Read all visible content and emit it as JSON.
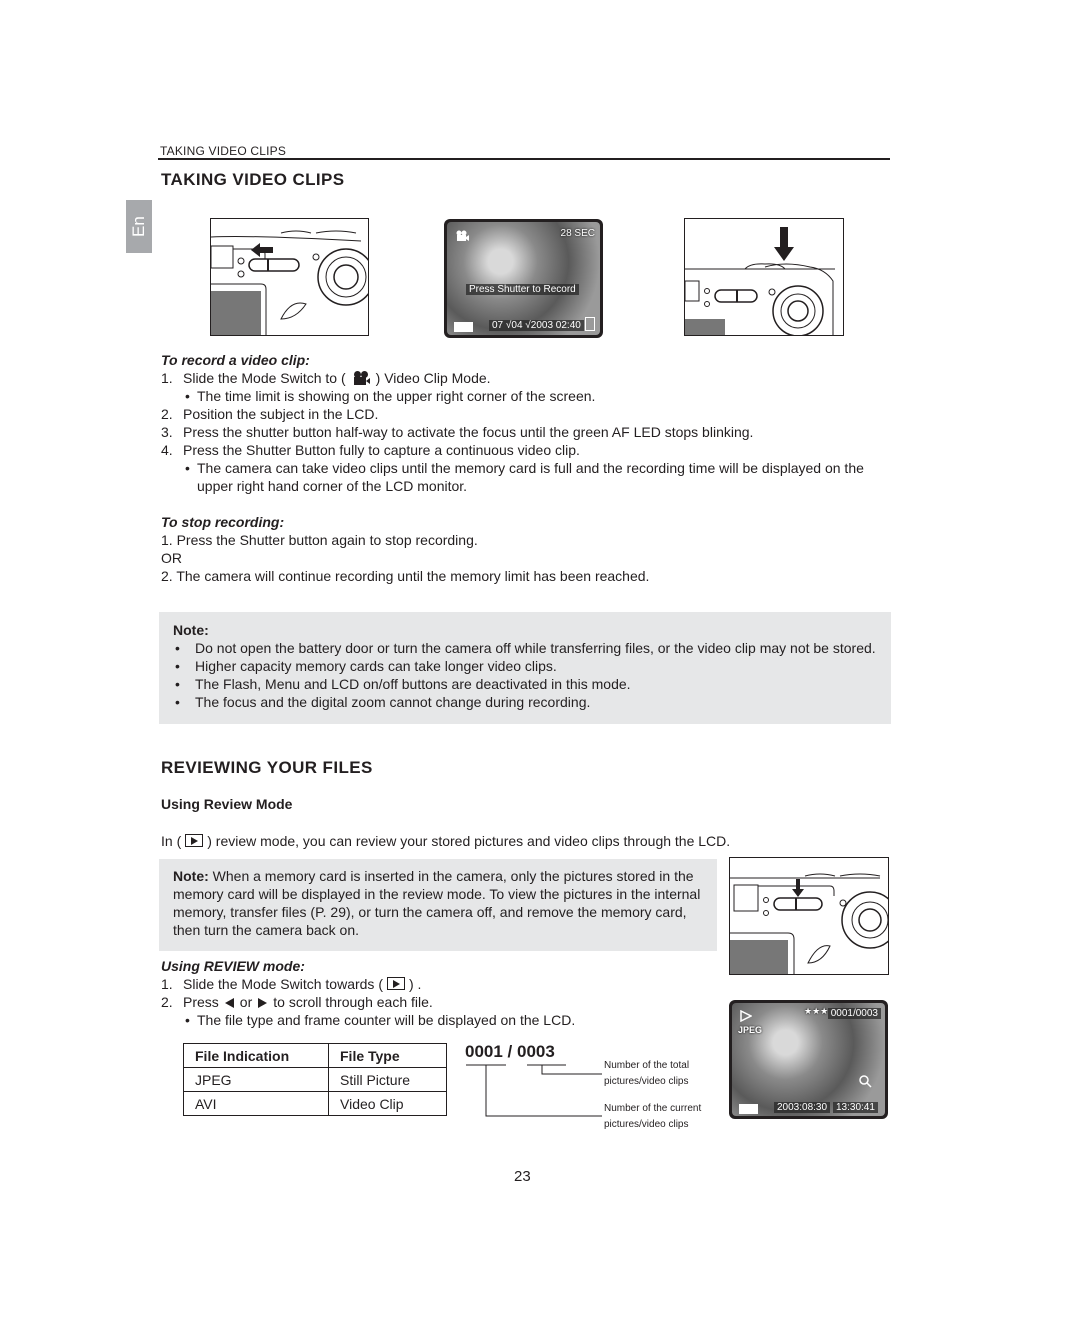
{
  "running_header": "TAKING VIDEO CLIPS",
  "language_tab": "En",
  "section1": {
    "title": "TAKING VIDEO CLIPS",
    "figures": {
      "fig1": {
        "icon": "left-arrow-icon",
        "description": "camera mode switch slid left"
      },
      "fig2": {
        "time_limit": "28 SEC",
        "prompt": "Press Shutter to Record",
        "datetime": "07 √04 √2003  02:40",
        "mode_icon": "video-camera-icon",
        "battery_icon": "battery-icon",
        "card_icon": "memory-card-icon"
      },
      "fig3": {
        "icon": "down-arrow-icon",
        "description": "shutter button pressed"
      }
    },
    "record": {
      "heading": "To record a video clip:",
      "steps": [
        {
          "num": "1.",
          "pre": "Slide the Mode Switch to (",
          "post": ") Video Clip Mode.",
          "icon": "video-camera-icon"
        },
        {
          "bullet": "•",
          "text": "The time limit is showing on the upper right corner of the screen."
        },
        {
          "num": "2.",
          "text": "Position the subject in the LCD."
        },
        {
          "num": "3.",
          "text": "Press the shutter button half-way to activate the focus until the green AF LED stops blinking."
        },
        {
          "num": "4.",
          "text": "Press the Shutter Button fully to capture a continuous video clip."
        },
        {
          "bullet": "•",
          "text": "The camera can take video clips until the memory card is full and the recording time will be displayed on the upper right hand corner of the LCD monitor."
        }
      ]
    },
    "stop": {
      "heading": "To stop recording:",
      "lines": [
        "1. Press the Shutter button again to stop recording.",
        "OR",
        "2. The camera will continue recording until the memory limit has been reached."
      ]
    },
    "note": {
      "title": "Note:",
      "bullet": "•",
      "items": [
        "Do not open the battery door or turn the camera off while transferring files, or the video clip may not be stored.",
        "Higher capacity memory cards can take longer video clips.",
        "The Flash, Menu and LCD on/off buttons are deactivated in this mode.",
        "The focus and the digital zoom cannot change during recording."
      ]
    }
  },
  "section2": {
    "title": "REVIEWING YOUR FILES",
    "subheading": "Using Review Mode",
    "intro_pre": "In (",
    "intro_post": ") review mode, you can review your stored pictures and video clips through the LCD.",
    "note": {
      "label": "Note:",
      "text": " When a memory card is inserted in the camera, only the pictures stored in the memory card will be displayed in the review mode. To view the pictures in the internal memory, transfer files (P. 29), or turn the camera off, and remove the memory card, then turn the camera back on."
    },
    "using": {
      "heading": "Using REVIEW mode:",
      "step1_num": "1.",
      "step1_pre": "Slide the Mode Switch towards (",
      "step1_post": ") .",
      "step2_num": "2.",
      "step2_pre": "Press",
      "step2_mid": "or",
      "step2_post": "to scroll through each file.",
      "bullet": "•",
      "bullet_text": "The file type and frame counter will be displayed on the LCD."
    },
    "table": {
      "headers": [
        "File Indication",
        "File Type"
      ],
      "rows": [
        [
          "JPEG",
          "Still Picture"
        ],
        [
          "AVI",
          "Video Clip"
        ]
      ]
    },
    "counter": {
      "current": "0001",
      "separator": " / ",
      "total": "0003",
      "callout_total": [
        "Number of the total",
        "pictures/video clips"
      ],
      "callout_current": [
        "Number of the current",
        "pictures/video clips"
      ]
    },
    "review_lcd": {
      "file_type": "JPEG",
      "quality": "★★★",
      "counter": "0001/0003",
      "date": "2003:08:30",
      "time": "13:30:41",
      "play_icon": "play-icon",
      "zoom_icon": "zoom-magnifier-icon",
      "battery_icon": "battery-icon"
    }
  },
  "page_number": "23"
}
